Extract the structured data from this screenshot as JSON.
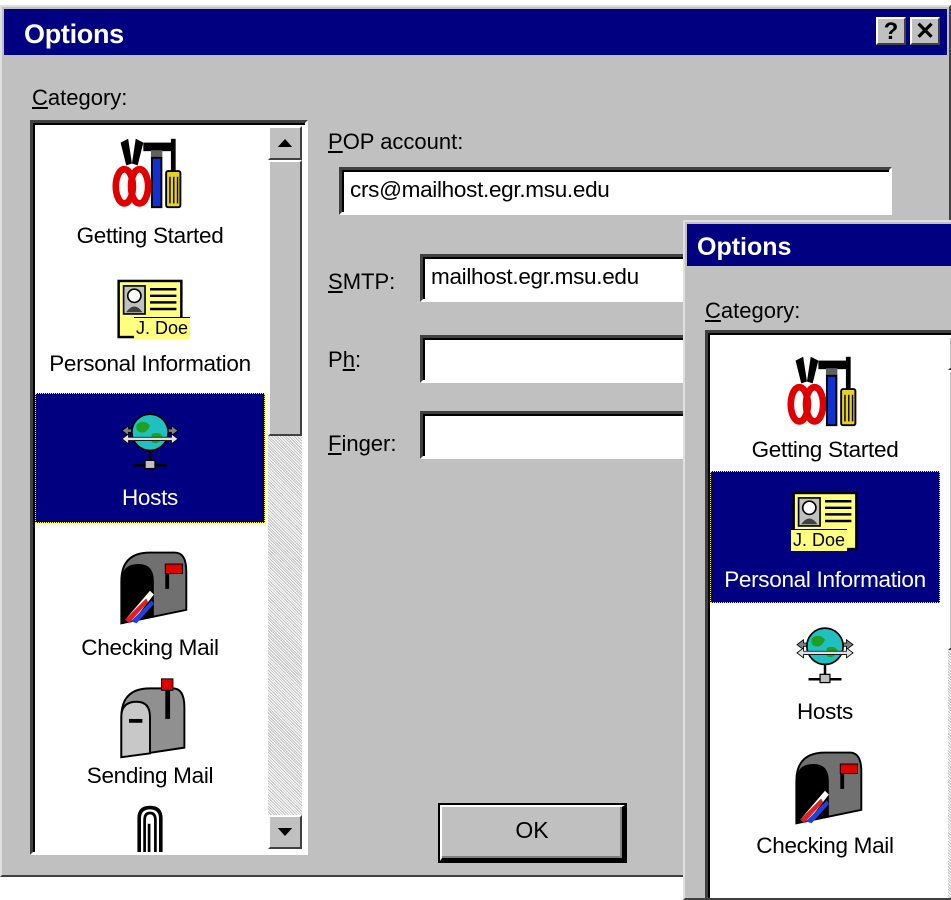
{
  "dialog": {
    "title": "Options",
    "help_button": "?",
    "close_button": "✕",
    "category_label_underlined": "C",
    "category_label_rest": "ategory:",
    "categories": [
      {
        "label": "Getting Started",
        "icon": "tools-icon"
      },
      {
        "label": "Personal Information",
        "icon": "id-card-icon"
      },
      {
        "label": "Hosts",
        "icon": "network-globe-icon",
        "selected": true
      },
      {
        "label": "Checking Mail",
        "icon": "mailbox-flag-up-icon"
      },
      {
        "label": "Sending Mail",
        "icon": "mailbox-closed-icon"
      }
    ],
    "form": {
      "pop_label_underlined": "P",
      "pop_label_rest": "OP account:",
      "pop_value": "crs@mailhost.egr.msu.edu",
      "smtp_label_underlined": "S",
      "smtp_label_rest": "MTP:",
      "smtp_value": "mailhost.egr.msu.edu",
      "ph_label_before": "P",
      "ph_label_underlined": "h",
      "ph_label_after": ":",
      "ph_value": "",
      "finger_label_underlined": "F",
      "finger_label_rest": "inger:",
      "finger_value": ""
    },
    "ok_button": "OK"
  },
  "dialog2": {
    "title": "Options",
    "category_label_underlined": "C",
    "category_label_rest": "ategory:",
    "categories": [
      {
        "label": "Getting Started",
        "icon": "tools-icon"
      },
      {
        "label": "Personal Information",
        "icon": "id-card-icon",
        "selected": true
      },
      {
        "label": "Hosts",
        "icon": "network-globe-icon"
      },
      {
        "label": "Checking Mail",
        "icon": "mailbox-flag-up-icon"
      }
    ]
  },
  "id_card_text": "J. Doe",
  "colors": {
    "titlebar": "#000080",
    "face": "#c0c0c0",
    "selection": "#000080"
  }
}
